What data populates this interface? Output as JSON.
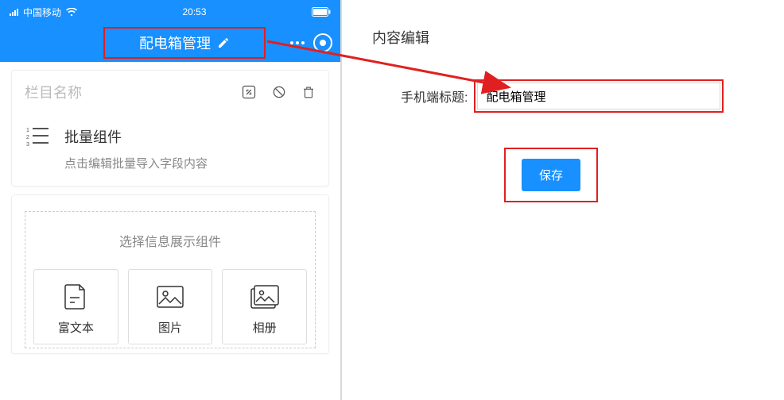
{
  "statusbar": {
    "carrier": "中国移动",
    "time": "20:53"
  },
  "header": {
    "title": "配电箱管理"
  },
  "section": {
    "title": "栏目名称"
  },
  "batch": {
    "title": "批量组件",
    "subtitle": "点击编辑批量导入字段内容"
  },
  "picker": {
    "title": "选择信息展示组件",
    "tiles": [
      {
        "label": "富文本"
      },
      {
        "label": "图片"
      },
      {
        "label": "相册"
      }
    ]
  },
  "right": {
    "panelTitle": "内容编辑",
    "formLabel": "手机端标题:",
    "inputValue": "配电箱管理",
    "saveLabel": "保存"
  },
  "colors": {
    "accent": "#1890ff",
    "highlight": "#e02020"
  }
}
